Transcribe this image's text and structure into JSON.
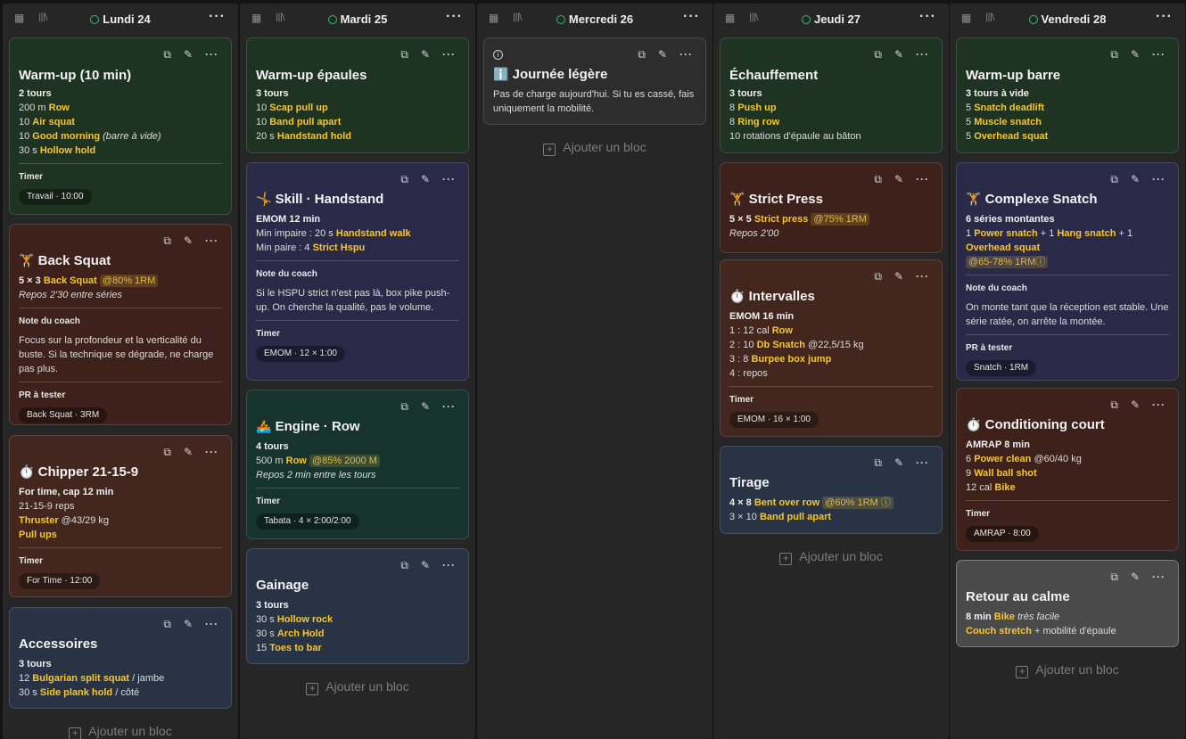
{
  "icons": {
    "calendar": "calendar-icon",
    "library": "library-icon",
    "more": "more-icon",
    "copy": "copy-icon",
    "edit": "pencil-icon",
    "info": "info-icon",
    "plus": "plus-icon"
  },
  "add_block": "Ajouter un bloc",
  "colors": {
    "accent": "#f6c631",
    "status_dot": "#2fbd84"
  },
  "columns": [
    {
      "day": "Lundi 24",
      "cards": [
        {
          "title": "Warm-up (10 min)",
          "lines": [
            [
              "2 tours"
            ],
            [
              "200 m ",
              "Row"
            ],
            [
              "10 ",
              "Air squat"
            ],
            [
              "10 ",
              "Good morning",
              " (barre à vide)"
            ],
            [
              "30 s ",
              "Hollow hold"
            ]
          ],
          "timer_label": "Timer",
          "timer": "Travail · 10:00"
        },
        {
          "title": "Back Squat",
          "emoji": "🏋️",
          "line1": [
            "5 × 3 ",
            "Back Squat",
            "@80% 1RM"
          ],
          "line2": "Repos 2'30 entre séries",
          "note_label": "Note du coach",
          "note": "Focus sur la profondeur et la verticalité du buste. Si la technique se dégrade, ne charge pas plus.",
          "pr_label": "PR à tester",
          "pr": "Back Squat · 3RM"
        },
        {
          "title": "Chipper 21-15-9",
          "emoji": "⏱️",
          "lines": [
            [
              "For time, cap 12 min"
            ],
            [
              "21-15-9 reps"
            ],
            [
              "",
              "Thruster",
              " @43/29 kg"
            ],
            [
              "",
              "Pull ups"
            ]
          ],
          "timer_label": "Timer",
          "timer": "For Time · 12:00"
        },
        {
          "title": "Accessoires",
          "lines": [
            [
              "3 tours"
            ],
            [
              "12 ",
              "Bulgarian split squat",
              " / jambe"
            ],
            [
              "30 s ",
              "Side plank hold",
              " / côté"
            ]
          ]
        }
      ]
    },
    {
      "day": "Mardi 25",
      "cards": [
        {
          "title": "Warm-up épaules",
          "lines": [
            [
              "3 tours"
            ],
            [
              "10 ",
              "Scap pull up"
            ],
            [
              "10 ",
              "Band pull apart"
            ],
            [
              "20 s ",
              "Handstand hold"
            ]
          ]
        },
        {
          "title": "Skill · Handstand",
          "emoji": "🤸",
          "lines": [
            [
              "EMOM 12 min"
            ],
            [
              "Min impaire : 20 s ",
              "Handstand walk"
            ],
            [
              "Min paire : 4 ",
              "Strict Hspu"
            ]
          ],
          "note_label": "Note du coach",
          "note": "Si le HSPU strict n'est pas là, box pike push-up. On cherche la qualité, pas le volume.",
          "timer_label": "Timer",
          "timer": "EMOM · 12 × 1:00"
        },
        {
          "title": "Engine · Row",
          "emoji": "🚣",
          "line0": "4 tours",
          "line1": [
            "500 m ",
            "Row",
            "@85% 2000 M"
          ],
          "line2": "Repos 2 min entre les tours",
          "timer_label": "Timer",
          "timer": "Tabata · 4 × 2:00/2:00"
        },
        {
          "title": "Gainage",
          "lines": [
            [
              "3 tours"
            ],
            [
              "30 s ",
              "Hollow rock"
            ],
            [
              "30 s ",
              "Arch Hold"
            ],
            [
              "15 ",
              "Toes to bar"
            ]
          ]
        }
      ]
    },
    {
      "day": "Mercredi 26",
      "cards": [
        {
          "title": "Journée légère",
          "emoji": "ℹ️",
          "text": "Pas de charge aujourd'hui. Si tu es cassé, fais uniquement la mobilité."
        }
      ]
    },
    {
      "day": "Jeudi 27",
      "cards": [
        {
          "title": "Échauffement",
          "lines": [
            [
              "3 tours"
            ],
            [
              "8 ",
              "Push up"
            ],
            [
              "8 ",
              "Ring row"
            ],
            [
              "10 rotations d'épaule au bâton"
            ]
          ]
        },
        {
          "title": "Strict Press",
          "emoji": "🏋️",
          "line1": [
            "5 × 5 ",
            "Strict press",
            "@75% 1RM"
          ],
          "line2": "Repos 2'00"
        },
        {
          "title": "Intervalles",
          "emoji": "⏱️",
          "lines": [
            [
              "EMOM 16 min"
            ],
            [
              "1 : 12 cal ",
              "Row"
            ],
            [
              "2 : 10 ",
              "Db Snatch",
              " @22,5/15 kg"
            ],
            [
              "3 : 8 ",
              "Burpee box jump"
            ],
            [
              "4 : repos"
            ]
          ],
          "timer_label": "Timer",
          "timer": "EMOM · 16 × 1:00"
        },
        {
          "title": "Tirage",
          "line1": [
            "4 × 8 ",
            "Bent over row",
            "@60% 1RM"
          ],
          "line2": [
            "3 × 10 ",
            "Band pull apart"
          ]
        }
      ]
    },
    {
      "day": "Vendredi 28",
      "cards": [
        {
          "title": "Warm-up barre",
          "lines": [
            [
              "3 tours à vide"
            ],
            [
              "5 ",
              "Snatch deadlift"
            ],
            [
              "5 ",
              "Muscle snatch"
            ],
            [
              "5 ",
              "Overhead squat"
            ]
          ]
        },
        {
          "title": "Complexe Snatch",
          "emoji": "🏋️",
          "line0": "6 séries montantes",
          "line1": [
            "1 ",
            "Power snatch",
            " + 1 ",
            "Hang snatch",
            " + 1"
          ],
          "line2": [
            "Overhead squat"
          ],
          "pill": "@65-78% 1RM",
          "note_label": "Note du coach",
          "note": "On monte tant que la réception est stable. Une série ratée, on arrête la montée.",
          "pr_label": "PR à tester",
          "pr": "Snatch · 1RM"
        },
        {
          "title": "Conditioning court",
          "emoji": "⏱️",
          "lines": [
            [
              "AMRAP 8 min"
            ],
            [
              "6 ",
              "Power clean",
              " @60/40 kg"
            ],
            [
              "9 ",
              "Wall ball shot"
            ],
            [
              "12 cal ",
              "Bike"
            ]
          ],
          "timer_label": "Timer",
          "timer": "AMRAP · 8:00"
        },
        {
          "title": "Retour au calme",
          "lines": [
            [
              "8 min",
              " ",
              "Bike",
              " très facile"
            ],
            [
              "",
              "Couch stretch",
              " + mobilité d'épaule"
            ]
          ]
        }
      ]
    }
  ]
}
